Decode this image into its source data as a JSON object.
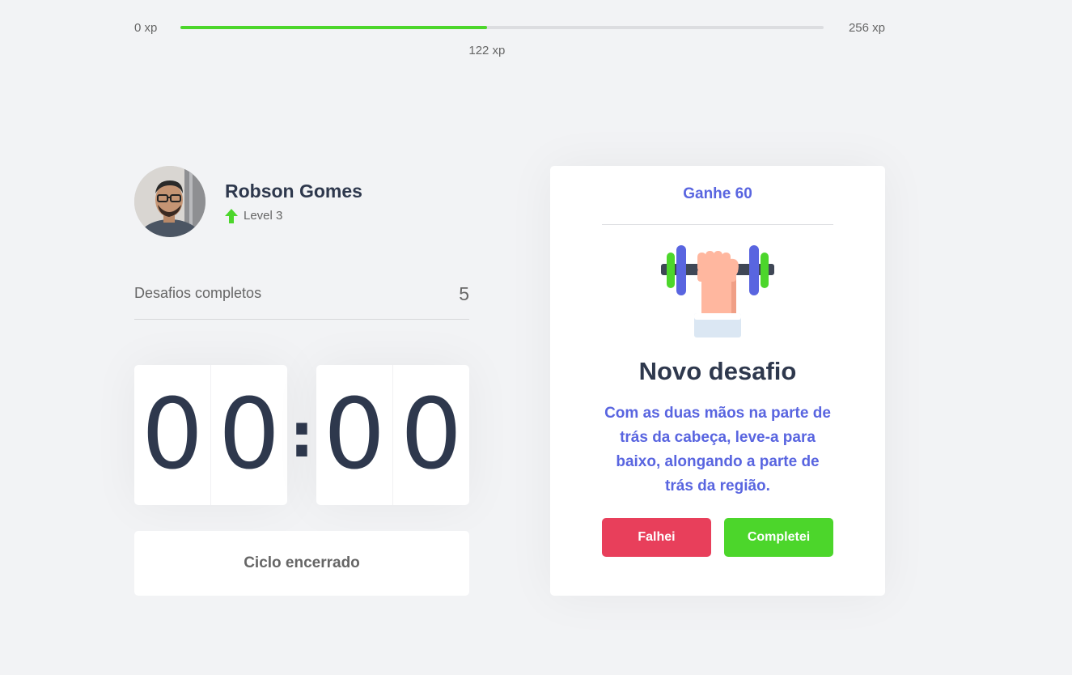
{
  "xp": {
    "min_label": "0 xp",
    "max_label": "256 xp",
    "current_label": "122 xp",
    "current": 122,
    "max": 256,
    "progress_fraction": 0.4766,
    "bar_color": "#4cd62b"
  },
  "profile": {
    "name": "Robson Gomes",
    "level_label": "Level 3",
    "level_icon": "up-arrow-icon"
  },
  "challenges": {
    "label": "Desafios completos",
    "count": "5"
  },
  "countdown": {
    "minute_left": "0",
    "minute_right": "0",
    "separator": ":",
    "second_left": "0",
    "second_right": "0"
  },
  "cycle_button": {
    "label": "Ciclo encerrado"
  },
  "challenge_card": {
    "header": "Ganhe 60",
    "illustration_icon": "dumbbell-icon",
    "title": "Novo desafio",
    "description": "Com as duas mãos na parte de trás da cabeça, leve-a para baixo, alongando a parte de trás da região.",
    "failed_label": "Falhei",
    "success_label": "Completei"
  },
  "colors": {
    "background": "#f2f3f5",
    "accent": "#5965e0",
    "title": "#2e384d",
    "green": "#4cd62b",
    "red": "#e83f5b"
  }
}
